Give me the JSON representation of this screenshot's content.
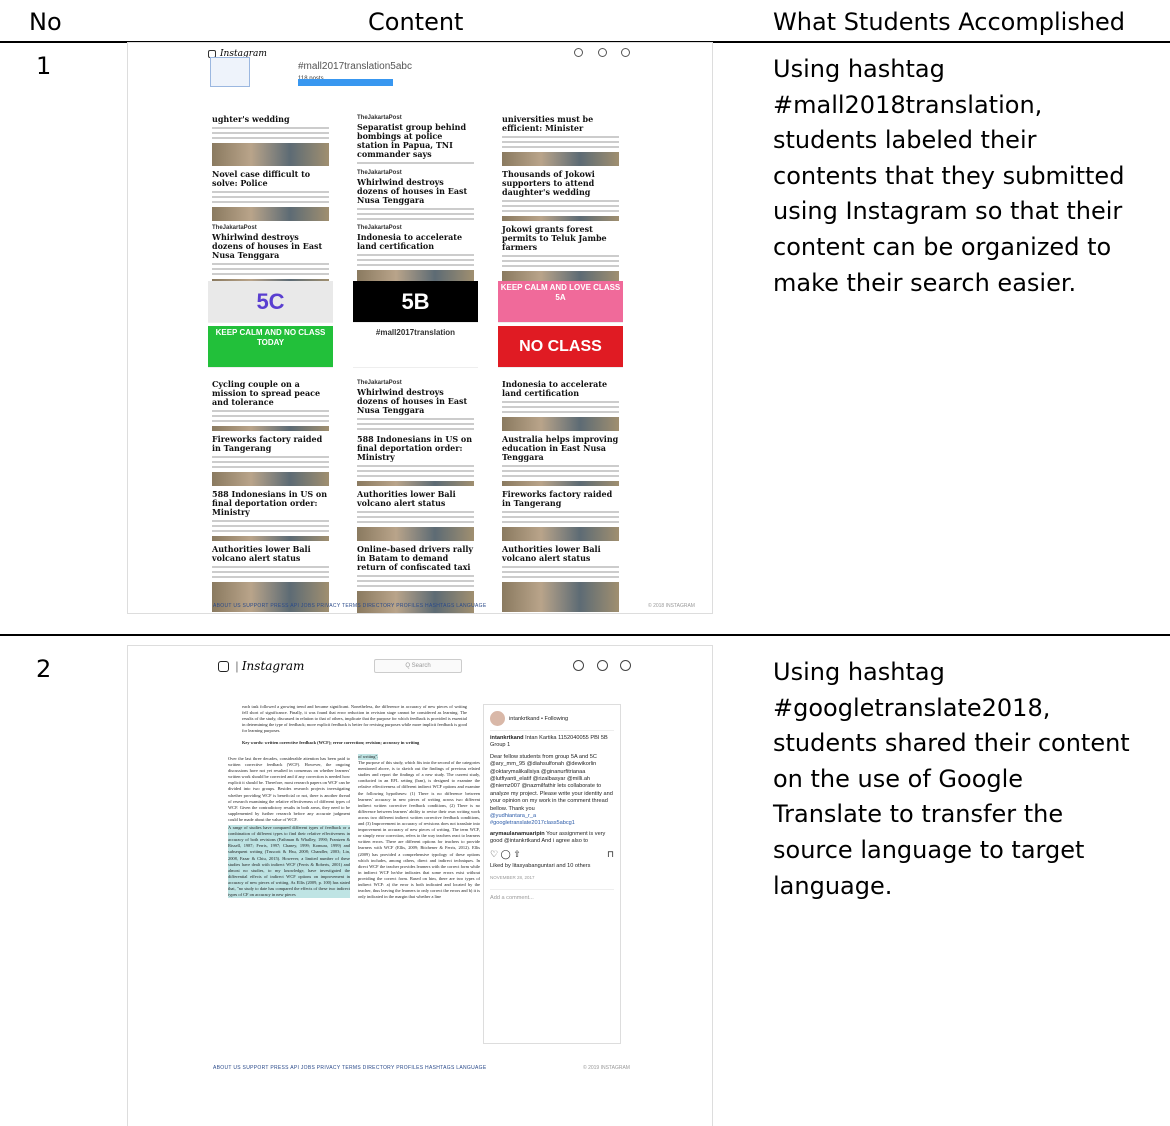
{
  "table": {
    "headers": {
      "no": "No",
      "content": "Content",
      "accomplished": "What Students Accomplished"
    },
    "rows": [
      {
        "no": "1",
        "description_lines": [
          "Using hashtag",
          "#mall2018translation,",
          "students labeled their",
          "contents that they submitted",
          "using Instagram so that their",
          "content can be organized to",
          "make their search easier."
        ]
      },
      {
        "no": "2",
        "description_lines": [
          "Using hashtag",
          "#googletranslate2018,",
          "students shared their content",
          "on the use of Google",
          "Translate to transfer the",
          "source language to target",
          "language."
        ]
      }
    ]
  },
  "shot1": {
    "logo": "Instagram",
    "hashtag": "#mall2017translation5abc",
    "posts": "118 posts",
    "tiles": [
      {
        "brand": "",
        "headline": "ughter's wedding"
      },
      {
        "brand": "TheJakartaPost",
        "headline": "Separatist group behind bombings at police station in Papua, TNI commander says"
      },
      {
        "brand": "",
        "headline": "universities must be efficient: Minister"
      },
      {
        "brand": "",
        "headline": "Novel case difficult to solve: Police"
      },
      {
        "brand": "TheJakartaPost",
        "headline": "Whirlwind destroys dozens of houses in East Nusa Tenggara"
      },
      {
        "brand": "",
        "headline": "Thousands of Jokowi supporters to attend daughter's wedding"
      },
      {
        "brand": "TheJakartaPost",
        "headline": "Whirlwind destroys dozens of houses in East Nusa Tenggara"
      },
      {
        "brand": "TheJakartaPost",
        "headline": "Indonesia to accelerate land certification"
      },
      {
        "brand": "",
        "headline": "Jokowi grants forest permits to Teluk Jambe farmers"
      }
    ],
    "posters": [
      {
        "text": "5C",
        "bg": "#e9e9e9",
        "fg": "#5a3fd0"
      },
      {
        "text": "5B",
        "bg": "#000000",
        "fg": "#ffffff"
      },
      {
        "text": "KEEP CALM AND LOVE CLASS 5A",
        "bg": "#f06a9a",
        "fg": "#ffffff"
      },
      {
        "text": "KEEP CALM AND NO CLASS TODAY",
        "bg": "#22c03a",
        "fg": "#ffffff"
      },
      {
        "text": "#mall2017translation",
        "bg": "#ffffff",
        "fg": "#333333"
      },
      {
        "text": "NO CLASS",
        "bg": "#e01b23",
        "fg": "#ffffff"
      }
    ],
    "tiles2": [
      {
        "brand": "",
        "headline": "Cycling couple on a mission to spread peace and tolerance"
      },
      {
        "brand": "TheJakartaPost",
        "headline": "Whirlwind destroys dozens of houses in East Nusa Tenggara"
      },
      {
        "brand": "",
        "headline": "Indonesia to accelerate land certification"
      },
      {
        "brand": "",
        "headline": "Fireworks factory raided in Tangerang"
      },
      {
        "brand": "",
        "headline": "588 Indonesians in US on final deportation order: Ministry"
      },
      {
        "brand": "",
        "headline": "Australia helps improving education in East Nusa Tenggara"
      },
      {
        "brand": "",
        "headline": "588 Indonesians in US on final deportation order: Ministry"
      },
      {
        "brand": "",
        "headline": "Authorities lower Bali volcano alert status"
      },
      {
        "brand": "",
        "headline": "Fireworks factory raided in Tangerang"
      },
      {
        "brand": "",
        "headline": "Authorities lower Bali volcano alert status"
      },
      {
        "brand": "",
        "headline": "Online-based drivers rally in Batam to demand return of confiscated taxi"
      },
      {
        "brand": "",
        "headline": "Authorities lower Bali volcano alert status"
      }
    ],
    "footer": "ABOUT US   SUPPORT   PRESS   API   JOBS   PRIVACY   TERMS   DIRECTORY   PROFILES   HASHTAGS   LANGUAGE",
    "copyright": "© 2018 INSTAGRAM"
  },
  "shot2": {
    "logo": "Instagram",
    "search_placeholder": "Q Search",
    "paper_intro": "each task followed a growing trend and became significant. Nonetheless, the difference in accuracy of new pieces of writing fell short of significance. Finally, it was found that error reduction in revision stage cannot be considered as learning. The results of the study, discussed in relation to that of others, implicate that the purpose for which feedback is provided is essential in determining the type of feedback; more explicit feedback is better for revising purposes while more implicit feedback is good for learning purposes.",
    "keywords": "Key words: written corrective feedback (WCF); error correction; revision; accuracy in writing",
    "col_left": "Over the last three decades, considerable attention has been paid to written corrective feedback (WCF). However, the ongoing discussions have not yet resulted in consensus on whether learners' written work should be corrected and if any correction is needed how explicit it should be. Therefore, most research papers on WCF can be divided into two groups. Besides research projects investigating whether providing WCF is beneficial or not, there is another thread of research examining the relative effectiveness of different types of WCF. Given the contradictory results in both areas, they need to be supplemented by further research before any accurate judgment could be made about the value of WCF.",
    "col_left_hi": "A range of studies have compared different types of feedback or a combination of different types to find their relative effectiveness in accuracy of both revisions (Fathman & Whalley, 1990; Frantzen & Rissell, 1987; Ferris, 1997; Chaney, 1999; Komura, 1999) and subsequent writing (Truscott & Hsu, 2008; Chandler, 2003; Lin, 2008, Fazar & Chiu, 2015). However, a limited number of these studies have dealt with indirect WCF (Ferris & Roberts, 2001) and almost no studies, to my knowledge, have investigated the differential effects of indirect WCF options on improvement in accuracy of new pieces of writing. As Ellis (2009, p. 100) has stated that, \"no study to date has compared the effects of these two indirect types of CF on accuracy in new pieces",
    "col_right_hi": "of writing\".",
    "col_right": "The purpose of this study, which fits into the second of the categories mentioned above, is to sketch out the findings of previous related studies and report the findings of a new study. The current study, conducted in an EFL setting (Iran), is designed to examine the relative effectiveness of different indirect WCF options and examine the following hypotheses: (1) There is no difference between learners' accuracy in new pieces of writing across two different indirect written corrective feedback conditions, (2) There is no difference between learners' ability to revise their own writing work across two different indirect written corrective feedback conditions, and (3) Improvement in accuracy of revisions does not translate into improvement in accuracy of new pieces of writing. The term WCF, or simply error correction, refers to the way teachers react to learners written errors. There are different options for teachers to provide learners with WCF (Ellis, 2009; Bitchener & Ferris, 2012). Ellis (2009) has provided a comprehensive typology of these options which includes, among others, direct and indirect techniques. In direct WCF the teacher provides learners with the correct form while in indirect WCF he/she indicates that some errors exist without providing the correct form. Based on him, there are two types of indirect WCF: a) the error is both indicated and located by the teacher, thus leaving the learners to only correct the errors and b) it is only indicated in the margin that whether a line",
    "user": "intankrtkand • Following",
    "caption_user": "intankrtkand",
    "caption": "Intan Kartika 1152040055 PBI 5B Group 1",
    "caption_body": "Dear fellow students from group 5A and 5C @ary_mm_95 @diahsulfonah @dewikorlin @oktarymalikallsiya @ginanurfitrianaa @lutfiyanti_elatif @rizalbasyar @milli.ah @niemz007 @nazmilfathir lets collaborate to analyze my project. Please write your identity and your opinion on my work in the comment thread bellow. Thank you",
    "caption_tags": "@yudhiantara_r_a #googletranslate2017class5abcg1",
    "commenter": "arymaulanamuaripin",
    "comment": "Your assignment is very good @intankrtkand And i agree also to",
    "likes": "Liked by litasyabanguntari and 10 others",
    "date": "NOVEMBER 28, 2017",
    "add_comment": "Add a comment...",
    "footer": "ABOUT US   SUPPORT   PRESS   API   JOBS   PRIVACY   TERMS   DIRECTORY   PROFILES   HASHTAGS   LANGUAGE",
    "copyright": "© 2019 INSTAGRAM"
  }
}
